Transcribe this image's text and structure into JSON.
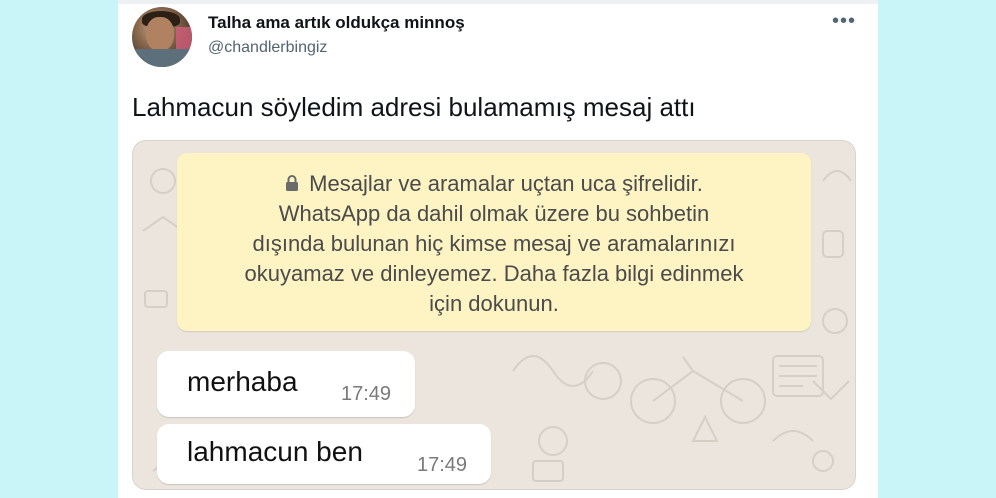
{
  "tweet": {
    "author_name": "Talha ama artık oldukça minnoş",
    "author_handle": "@chandlerbingiz",
    "more_icon": "more-horizontal-icon",
    "text": "Lahmacun söyledim adresi bulamamış mesaj attı"
  },
  "chat": {
    "notice_lines": [
      "Mesajlar ve aramalar uçtan uca şifrelidir.",
      "WhatsApp da dahil olmak üzere bu sohbetin",
      "dışında bulunan hiç kimse mesaj ve aramalarınızı",
      "okuyamaz ve dinleyemez. Daha fazla bilgi edinmek",
      "için dokunun."
    ],
    "messages": [
      {
        "text": "merhaba",
        "time": "17:49"
      },
      {
        "text": "lahmacun ben",
        "time": "17:49"
      }
    ]
  },
  "colors": {
    "page_background": "#c9f4f8",
    "chat_background": "#ece5dd",
    "notice_background": "#fdf3c3",
    "bubble_background": "#ffffff"
  }
}
